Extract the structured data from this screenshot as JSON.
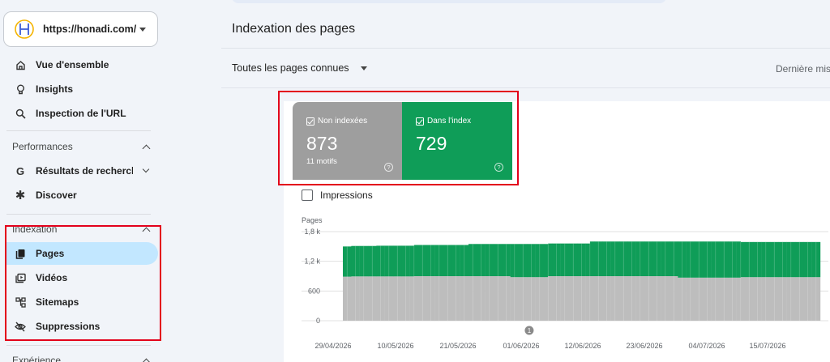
{
  "sidebar": {
    "property_url": "https://honadi.com/",
    "items_top": [
      {
        "label": "Vue d'ensemble",
        "icon": "home-icon"
      },
      {
        "label": "Insights",
        "icon": "lightbulb-icon"
      },
      {
        "label": "Inspection de l'URL",
        "icon": "search-icon"
      }
    ],
    "sections": {
      "performance": "Performances",
      "indexation": "Indexation",
      "experience": "Expérience"
    },
    "perf_items": [
      {
        "label": "Résultats de recherche",
        "icon": "google-g-icon"
      },
      {
        "label": "Discover",
        "icon": "asterisk-icon"
      }
    ],
    "index_items": [
      {
        "label": "Pages",
        "icon": "pages-icon",
        "active": true
      },
      {
        "label": "Vidéos",
        "icon": "video-icon"
      },
      {
        "label": "Sitemaps",
        "icon": "sitemap-icon"
      },
      {
        "label": "Suppressions",
        "icon": "eye-off-icon"
      }
    ]
  },
  "main": {
    "title": "Indexation des pages",
    "filter": "Toutes les pages connues",
    "last_update": "Dernière mise"
  },
  "tiles": {
    "not_indexed": {
      "label": "Non indexées",
      "value": "873",
      "sub": "11 motifs",
      "color": "#9e9e9e"
    },
    "indexed": {
      "label": "Dans l'index",
      "value": "729",
      "color": "#0f9d58"
    }
  },
  "impressions_label": "Impressions",
  "chart_data": {
    "type": "bar",
    "stacked": true,
    "ylabel": "Pages",
    "ylim": [
      0,
      1800
    ],
    "yticks": [
      "0",
      "600",
      "1,2 k",
      "1,8 k"
    ],
    "ytick_values": [
      0,
      600,
      1200,
      1800
    ],
    "xtick_labels": [
      "29/04/2026",
      "10/05/2026",
      "21/05/2026",
      "01/06/2026",
      "12/06/2026",
      "23/06/2026",
      "04/07/2026",
      "15/07/2026"
    ],
    "annotation": "1",
    "series": [
      {
        "name": "Non indexées",
        "color": "#bdbdbd",
        "values": [
          890,
          890,
          895,
          895,
          895,
          895,
          895,
          895,
          895,
          895,
          895,
          895,
          895,
          895,
          895,
          895,
          895,
          900,
          900,
          900,
          900,
          900,
          900,
          900,
          900,
          900,
          900,
          900,
          900,
          900,
          900,
          900,
          900,
          900,
          900,
          900,
          900,
          900,
          900,
          900,
          880,
          880,
          880,
          880,
          880,
          880,
          880,
          880,
          880,
          900,
          900,
          900,
          900,
          900,
          900,
          900,
          900,
          900,
          900,
          900,
          900,
          900,
          900,
          900,
          900,
          900,
          900,
          900,
          900,
          900,
          900,
          900,
          900,
          900,
          900,
          900,
          900,
          900,
          900,
          900,
          870,
          870,
          870,
          870,
          870,
          870,
          870,
          870,
          870,
          870,
          870,
          870,
          870,
          870,
          870,
          880,
          880,
          880,
          880,
          880,
          880,
          880,
          880,
          880,
          880,
          880,
          880,
          880,
          880,
          880,
          880,
          880,
          880,
          880
        ]
      },
      {
        "name": "Dans l'index",
        "color": "#0f9d58",
        "values": [
          610,
          610,
          615,
          615,
          615,
          615,
          615,
          615,
          620,
          620,
          620,
          620,
          620,
          620,
          620,
          620,
          620,
          630,
          630,
          630,
          630,
          630,
          630,
          630,
          630,
          630,
          630,
          630,
          630,
          630,
          650,
          650,
          650,
          650,
          650,
          650,
          650,
          650,
          650,
          650,
          670,
          670,
          670,
          670,
          670,
          670,
          670,
          670,
          670,
          660,
          660,
          660,
          660,
          660,
          660,
          660,
          660,
          660,
          660,
          700,
          700,
          700,
          700,
          700,
          700,
          700,
          700,
          700,
          700,
          700,
          700,
          700,
          700,
          700,
          700,
          700,
          700,
          700,
          700,
          700,
          730,
          730,
          730,
          730,
          730,
          730,
          730,
          730,
          730,
          730,
          730,
          730,
          730,
          730,
          730,
          710,
          710,
          710,
          710,
          710,
          710,
          710,
          710,
          710,
          710,
          710,
          710,
          710,
          710,
          710,
          710,
          710,
          710,
          710
        ]
      }
    ]
  }
}
